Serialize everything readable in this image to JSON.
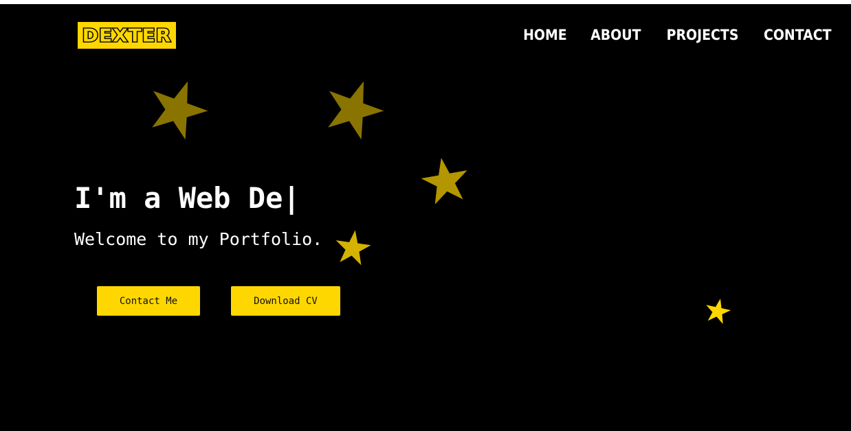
{
  "header": {
    "logo_text": "DEXTER",
    "nav": [
      {
        "label": "HOME"
      },
      {
        "label": "ABOUT"
      },
      {
        "label": "PROJECTS"
      },
      {
        "label": "CONTACT"
      }
    ]
  },
  "hero": {
    "typed_text": "I'm a Web De",
    "cursor": "|",
    "subtitle": "Welcome to my Portfolio.",
    "buttons": {
      "contact_label": "Contact Me",
      "cv_label": "Download CV"
    }
  },
  "colors": {
    "background": "#000000",
    "accent": "#ffd700",
    "text": "#ffffff",
    "star_dim": "#8a7400"
  },
  "decorations": {
    "icon": "star-icon"
  }
}
